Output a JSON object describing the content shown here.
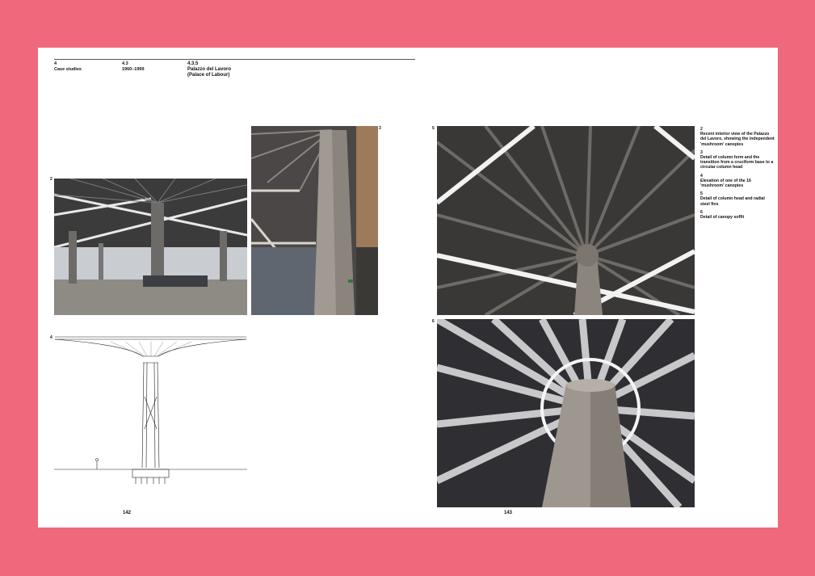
{
  "header": {
    "chapter_number": "4",
    "chapter_title": "Case studies",
    "section_number": "4.3",
    "section_period": "1960–1999",
    "case_number": "4.3.5",
    "case_title": "Palazzo del Lavoro",
    "case_subtitle": "(Palace of Labour)"
  },
  "figures": {
    "fig2_number": "2",
    "fig3_number": "3",
    "fig4_number": "4",
    "fig5_number": "5",
    "fig6_number": "6"
  },
  "captions": [
    {
      "number": "2",
      "text": "Recent interior view of the Palazzo del Lavoro, showing the independent 'mushroom' canopies"
    },
    {
      "number": "3",
      "text": "Detail of column form and the transition from a cruciform base to a circular column head"
    },
    {
      "number": "4",
      "text": "Elevation of one of the 16 'mushroom' canopies"
    },
    {
      "number": "5",
      "text": "Detail of column head and radial steel fins"
    },
    {
      "number": "6",
      "text": "Detail of canopy soffit"
    }
  ],
  "folios": {
    "left": "142",
    "right": "143"
  },
  "colors": {
    "background": "#f0687c",
    "page": "#ffffff"
  }
}
